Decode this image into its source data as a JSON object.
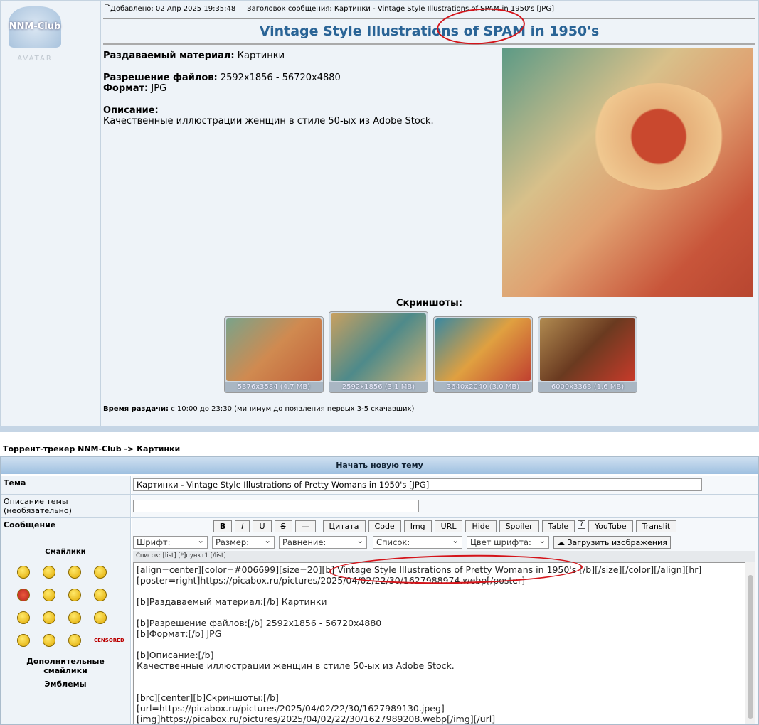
{
  "post": {
    "avatar_logo": "NNM-Club",
    "avatar_label": "AVATAR",
    "added": "Добавлено: 02 Апр 2025 19:35:48",
    "subject": "Заголовок сообщения: Картинки - Vintage Style Illustrations of SPAM in 1950's [JPG]",
    "title": "Vintage Style Illustrations of SPAM in 1950's",
    "material_label": "Раздаваемый материал:",
    "material": " Картинки",
    "resolution_label": "Разрешение файлов:",
    "resolution": " 2592x1856 - 56720x4880",
    "format_label": "Формат:",
    "format": " JPG",
    "desc_label": "Описание:",
    "desc": "Качественные иллюстрации женщин в стиле 50-ых из Adobe Stock.",
    "screens_label": "Скриншоты:",
    "thumbs": [
      {
        "caption": "5376x3584 (4.7 MB)"
      },
      {
        "caption": "2592x1856 (3.1 MB)"
      },
      {
        "caption": "3640x2040 (3.0 MB)"
      },
      {
        "caption": "6000x3363 (1.6 MB)"
      }
    ],
    "time_label": "Время раздачи:",
    "time": " с 10:00 до 23:30 (минимум до появления первых 3-5 скачавших)"
  },
  "breadcrumb": "Торрент-трекер NNM-Club -> Картинки",
  "form": {
    "header": "Начать новую тему",
    "topic_label": "Тема",
    "topic_value": "Картинки - Vintage Style Illustrations of Pretty Womans in 1950's [JPG]",
    "desc_label": "Описание темы (необязательно)",
    "desc_value": "",
    "message_label": "Сообщение",
    "smilies_label": "Смайлики",
    "more_smilies": "Дополнительные смайлики",
    "emblems": "Эмблемы",
    "censored": "CENSORED",
    "buttons": [
      "B",
      "I",
      "U",
      "S",
      "—",
      "Цитата",
      "Code",
      "Img",
      "URL",
      "Hide",
      "Spoiler",
      "Table",
      "?",
      "YouTube",
      "Translit"
    ],
    "selects": [
      "Шрифт:",
      "Размер:",
      "Равнение:",
      "Список:",
      "Цвет шрифта:"
    ],
    "upload": "Загрузить изображения",
    "hint": "Список: [list] [*]пункт1 [/list]",
    "text": "[align=center][color=#006699][size=20][b] Vintage Style Illustrations of Pretty Womans in 1950's [/b][/size][/color][/align][hr]\n[poster=right]https://picabox.ru/pictures/2025/04/02/22/30/1627988974.webp[/poster]\n\n[b]Раздаваемый материал:[/b] Картинки\n\n[b]Разрешение файлов:[/b] 2592x1856 - 56720x4880\n[b]Формат:[/b] JPG\n\n[b]Описание:[/b]\nКачественные иллюстрации женщин в стиле 50-ых из Adobe Stock.\n\n\n[brc][center][b]Скриншоты:[/b]\n[url=https://picabox.ru/pictures/2025/04/02/22/30/1627989130.jpeg]\n[img]https://picabox.ru/pictures/2025/04/02/22/30/1627989208.webp[/img][/url]"
  },
  "colors": {
    "title": "#2a6496",
    "annotation": "#d4141a"
  }
}
